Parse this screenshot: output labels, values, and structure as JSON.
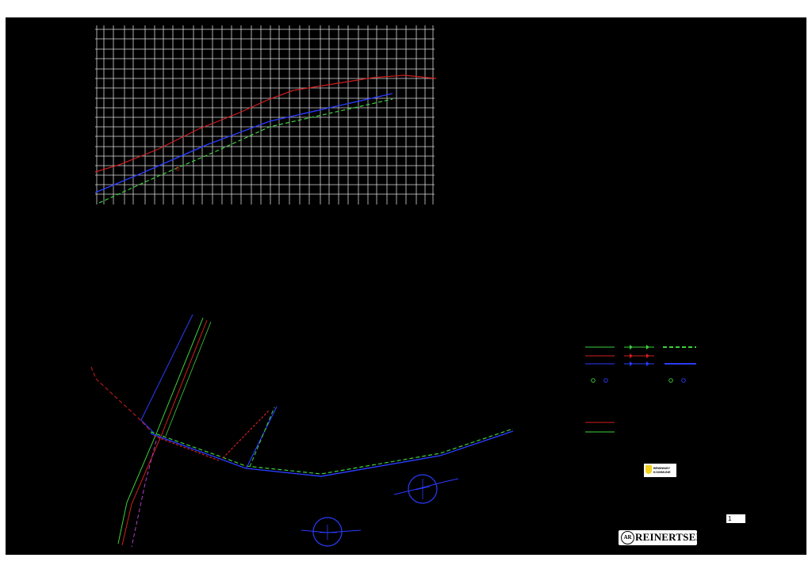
{
  "sheet": {
    "number": "1"
  },
  "logos": {
    "client_line1": "BRØNNØY",
    "client_line2": "KOMMUNE",
    "company_emblem": "AR",
    "company_name": "REINERTSEN"
  },
  "colors": {
    "background": "#000000",
    "grid": "#d8d8d8",
    "terrain": "#d21e1e",
    "water_main": "#2a3cff",
    "sewer": "#3cd23c",
    "logo_yellow": "#f2d21b"
  }
}
